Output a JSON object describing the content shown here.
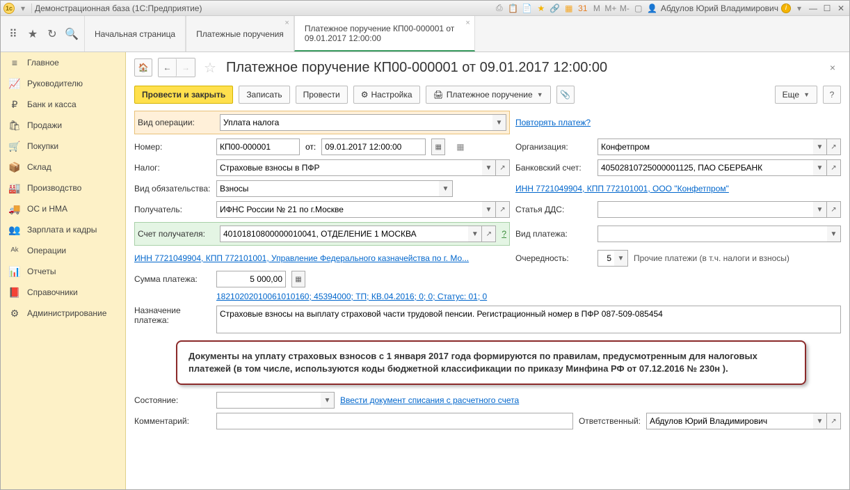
{
  "titlebar": {
    "title": "Демонстрационная база  (1С:Предприятие)",
    "user": "Абдулов Юрий Владимирович"
  },
  "tabs": {
    "t1": "Начальная страница",
    "t2": "Платежные поручения",
    "t3": "Платежное поручение КП00-000001 от 09.01.2017 12:00:00"
  },
  "sidebar": {
    "items": [
      {
        "label": "Главное"
      },
      {
        "label": "Руководителю"
      },
      {
        "label": "Банк и касса"
      },
      {
        "label": "Продажи"
      },
      {
        "label": "Покупки"
      },
      {
        "label": "Склад"
      },
      {
        "label": "Производство"
      },
      {
        "label": "ОС и НМА"
      },
      {
        "label": "Зарплата и кадры"
      },
      {
        "label": "Операции"
      },
      {
        "label": "Отчеты"
      },
      {
        "label": "Справочники"
      },
      {
        "label": "Администрирование"
      }
    ]
  },
  "doc": {
    "title": "Платежное поручение КП00-000001 от 09.01.2017 12:00:00",
    "toolbar": {
      "post_close": "Провести и закрыть",
      "write": "Записать",
      "post": "Провести",
      "settings": "Настройка",
      "print": "Платежное поручение",
      "more": "Еще",
      "help": "?"
    },
    "labels": {
      "op_type": "Вид операции:",
      "number": "Номер:",
      "from": "от:",
      "tax": "Налог:",
      "obl_type": "Вид обязательства:",
      "recipient": "Получатель:",
      "rec_acct": "Счет получателя:",
      "amount": "Сумма платежа:",
      "purpose": "Назначение платежа:",
      "state": "Состояние:",
      "comment": "Комментарий:",
      "org": "Организация:",
      "bank_acct": "Банковский счет:",
      "dds": "Статья ДДС:",
      "pay_type": "Вид платежа:",
      "priority": "Очередность:",
      "resp": "Ответственный:"
    },
    "values": {
      "op_type": "Уплата налога",
      "repeat_link": "Повторять платеж?",
      "number": "КП00-000001",
      "date": "09.01.2017 12:00:00",
      "tax": "Страховые взносы в ПФР",
      "obl_type": "Взносы",
      "recipient": "ИФНС России № 21 по г.Москве",
      "rec_acct": "40101810800000010041, ОТДЕЛЕНИЕ 1 МОСКВА",
      "rec_acct_help": "?",
      "inn_link": "ИНН 7721049904, КПП 772101001, Управление Федерального казначейства по г. Мо...",
      "amount": "5 000,00",
      "kbk_link": "18210202010061010160; 45394000; ТП; КВ.04.2016; 0; 0; Статус: 01; 0",
      "purpose": "Страховые взносы на выплату страховой части трудовой пенсии. Регистрационный номер в ПФР 087-509-085454",
      "state_link": "Ввести документ списания с расчетного счета",
      "org": "Конфетпром",
      "bank_acct": "40502810725000001125, ПАО СБЕРБАНК",
      "org_inn_link": "ИНН 7721049904, КПП 772101001, ООО \"Конфетпром\"",
      "priority": "5",
      "priority_note": "Прочие платежи (в т.ч. налоги и взносы)",
      "resp": "Абдулов Юрий Владимирович"
    },
    "callout": "Документы на уплату страховых взносов с 1 января 2017 года формируются по правилам, предусмотренным для налоговых платежей (в том числе, используются коды бюджетной классификации по приказу Минфина РФ от 07.12.2016 № 230н )."
  }
}
